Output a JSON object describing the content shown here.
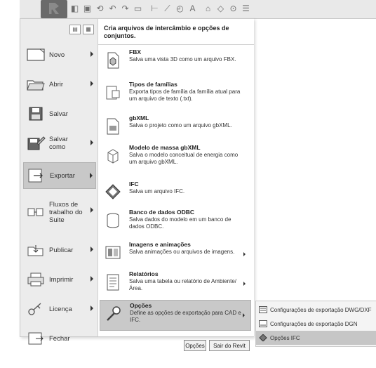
{
  "left_menu": {
    "items": [
      {
        "label": "Novo"
      },
      {
        "label": "Abrir"
      },
      {
        "label": "Salvar"
      },
      {
        "label": "Salvar como"
      },
      {
        "label": "Exportar"
      },
      {
        "label": "Fluxos de trabalho do Suite"
      },
      {
        "label": "Publicar"
      },
      {
        "label": "Imprimir"
      },
      {
        "label": "Licença"
      },
      {
        "label": "Fechar"
      }
    ]
  },
  "right_panel": {
    "header": "Cria arquivos de intercâmbio e opções de conjuntos.",
    "entries": [
      {
        "title": "FBX",
        "desc": "Salva uma vista 3D como um arquivo FBX."
      },
      {
        "title": "Tipos de famílias",
        "desc": "Exporta tipos de família da família atual para um arquivo de texto (.txt)."
      },
      {
        "title": "gbXML",
        "desc": "Salva o projeto como um arquivo gbXML."
      },
      {
        "title": "Modelo de massa gbXML",
        "desc": "Salva o modelo conceitual de energia como um arquivo gbXML."
      },
      {
        "title": "IFC",
        "desc": "Salva um arquivo IFC."
      },
      {
        "title": "Banco de dados ODBC",
        "desc": "Salva dados do modelo em um banco de dados ODBC."
      },
      {
        "title": "Imagens e animações",
        "desc": "Salva animações ou arquivos de imagens."
      },
      {
        "title": "Relatórios",
        "desc": "Salva uma tabela ou relatório de Ambiente/Área."
      },
      {
        "title": "Opções",
        "desc": "Define as opções de exportação para CAD e IFC."
      }
    ]
  },
  "submenu": {
    "items": [
      {
        "label": "Configurações de exportação DWG/DXF"
      },
      {
        "label": "Configurações de exportação DGN"
      },
      {
        "label": "Opções IFC"
      }
    ]
  },
  "bottom_buttons": {
    "options": "Opções",
    "exit": "Sair do Revit"
  },
  "icons": {
    "app_button": "revit-r-icon",
    "qat": [
      "open-icon",
      "save-icon",
      "undo-icon",
      "redo-icon",
      "measure-icon",
      "dimension-icon",
      "text-icon",
      "3d-icon",
      "section-icon",
      "thin-lines-icon"
    ]
  }
}
